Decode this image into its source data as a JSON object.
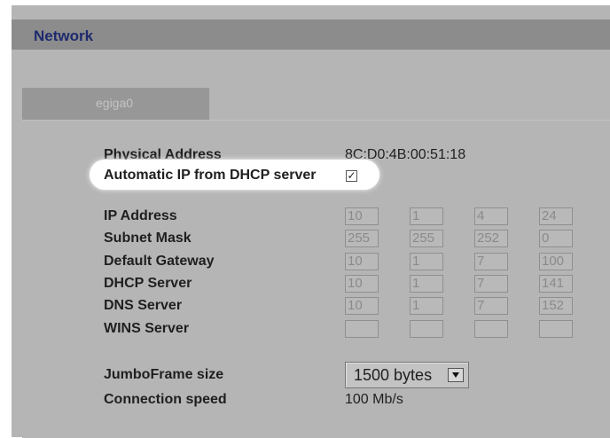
{
  "header": {
    "title": "Network"
  },
  "tabs": [
    {
      "label": "egiga0"
    }
  ],
  "form": {
    "physical_address": {
      "label": "Physical Address",
      "value": "8C:D0:4B:00:51:18"
    },
    "dhcp_auto": {
      "label": "Automatic IP from DHCP server",
      "checked": true,
      "check_glyph": "✓"
    },
    "ip_address": {
      "label": "IP Address",
      "octets": [
        "10",
        "1",
        "4",
        "24"
      ]
    },
    "subnet_mask": {
      "label": "Subnet Mask",
      "octets": [
        "255",
        "255",
        "252",
        "0"
      ]
    },
    "default_gateway": {
      "label": "Default Gateway",
      "octets": [
        "10",
        "1",
        "7",
        "100"
      ]
    },
    "dhcp_server": {
      "label": "DHCP Server",
      "octets": [
        "10",
        "1",
        "7",
        "141"
      ]
    },
    "dns_server": {
      "label": "DNS Server",
      "octets": [
        "10",
        "1",
        "7",
        "152"
      ]
    },
    "wins_server": {
      "label": "WINS Server",
      "octets": [
        "",
        "",
        "",
        ""
      ]
    },
    "jumbo_frame": {
      "label": "JumboFrame size",
      "selected": "1500 bytes"
    },
    "connection_speed": {
      "label": "Connection speed",
      "value": "100 Mb/s"
    }
  },
  "colors": {
    "title": "#1e2a6e",
    "panel": "#b5b5b5",
    "header": "#8c8c8c"
  }
}
